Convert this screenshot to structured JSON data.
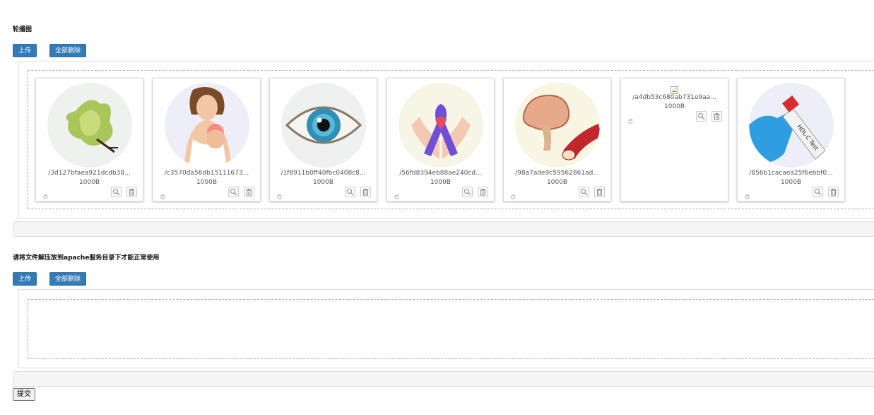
{
  "carousel": {
    "title": "轮播图",
    "upload_label": "上传",
    "delete_all_label": "全部删除",
    "items": [
      {
        "name": "/3d127bfaea921dcdb38...",
        "size": "1000B",
        "image": "magnolia-flower"
      },
      {
        "name": "/c3570da56db15111673...",
        "size": "1000B",
        "image": "woman-chest-pain"
      },
      {
        "name": "/1f8911b0ff40fbc0408c8...",
        "size": "1000B",
        "image": "eye"
      },
      {
        "name": "/56fd8394eb88ae240cd...",
        "size": "1000B",
        "image": "hands-ribbon"
      },
      {
        "name": "/98a7ade9c59562861ad...",
        "size": "1000B",
        "image": "brain-artery"
      },
      {
        "name": "/a4db53c680ab731e9aa...",
        "size": "1000B",
        "image": "broken-image"
      },
      {
        "name": "/856b1cacaea25f6ebbf0...",
        "size": "1000B",
        "image": "hdl-c-test-tube"
      }
    ],
    "tube_label": "HDL-C Test"
  },
  "files": {
    "title": "请将文件解压放到apache服务目录下才能正常使用",
    "upload_label": "上传",
    "delete_all_label": "全部删除"
  },
  "submit_label": "提交"
}
